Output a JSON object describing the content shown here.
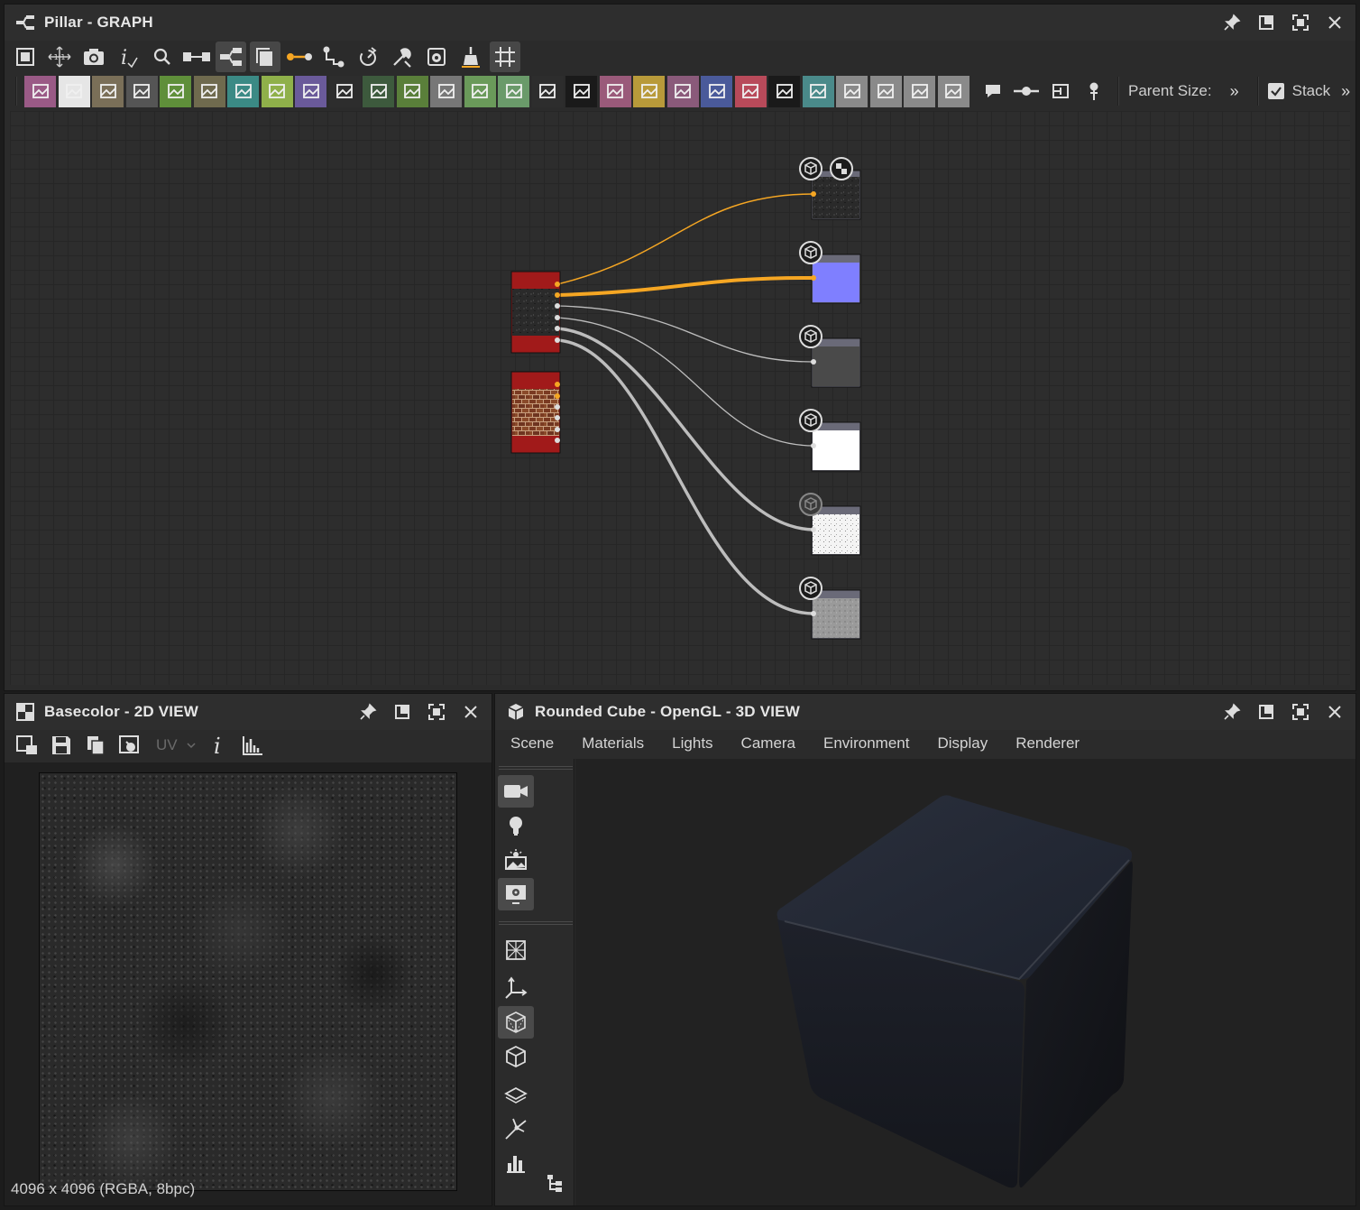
{
  "graph_panel": {
    "title": "Pillar - GRAPH",
    "parent_size_label": "Parent Size:",
    "stack_label": "Stack",
    "stack_checked": true
  },
  "view2d_panel": {
    "title": "Basecolor - 2D VIEW",
    "uv_label": "UV",
    "status": "4096 x 4096 (RGBA, 8bpc)"
  },
  "view3d_panel": {
    "title": "Rounded Cube - OpenGL - 3D VIEW",
    "menu": [
      "Scene",
      "Materials",
      "Lights",
      "Camera",
      "Environment",
      "Display",
      "Renderer"
    ]
  },
  "atom_icons": [
    {
      "name": "bitmap-icon",
      "color": "#9a5a86"
    },
    {
      "name": "svg-icon",
      "color": "#e6e6e6"
    },
    {
      "name": "uniform-color-icon",
      "color": "#7a6f58"
    },
    {
      "name": "blend-icon",
      "color": "#555555"
    },
    {
      "name": "levels-icon",
      "color": "#5f8f3a"
    },
    {
      "name": "hsl-icon",
      "color": "#6f6a4e"
    },
    {
      "name": "transform-icon",
      "color": "#3b8a85"
    },
    {
      "name": "gradient-map-icon",
      "color": "#8fb04a"
    },
    {
      "name": "shape-icon",
      "color": "#6a5a9a"
    },
    {
      "name": "tile-generator-icon",
      "color": "#2d2d2d"
    },
    {
      "name": "fx-map-icon",
      "color": "#3d5a3d"
    },
    {
      "name": "pixel-processor-icon",
      "color": "#5a7f3a"
    },
    {
      "name": "value-processor-icon",
      "color": "#777777"
    },
    {
      "name": "grayscale-conversion-icon",
      "color": "#6a9a5a"
    },
    {
      "name": "histogram-icon",
      "color": "#6a9a6a"
    },
    {
      "name": "hue-icon",
      "color": "#2d2d2d"
    },
    {
      "name": "noise-icon",
      "color": "#1a1a1a"
    },
    {
      "name": "warp-icon",
      "color": "#9a5a7a"
    },
    {
      "name": "mirror-icon",
      "color": "#b89a3a"
    },
    {
      "name": "text-icon",
      "color": "#8a5a7a"
    },
    {
      "name": "crop-icon",
      "color": "#4a5a9a"
    },
    {
      "name": "paint-icon",
      "color": "#b84a5a"
    },
    {
      "name": "curve-icon",
      "color": "#1a1a1a"
    },
    {
      "name": "normal-icon",
      "color": "#4a8a8a"
    },
    {
      "name": "input-icon",
      "color": "#8a8a8a"
    },
    {
      "name": "output-icon",
      "color": "#8a8a8a"
    },
    {
      "name": "graph-instance-icon",
      "color": "#8a8a8a"
    },
    {
      "name": "frame-icon",
      "color": "#8a8a8a"
    }
  ]
}
